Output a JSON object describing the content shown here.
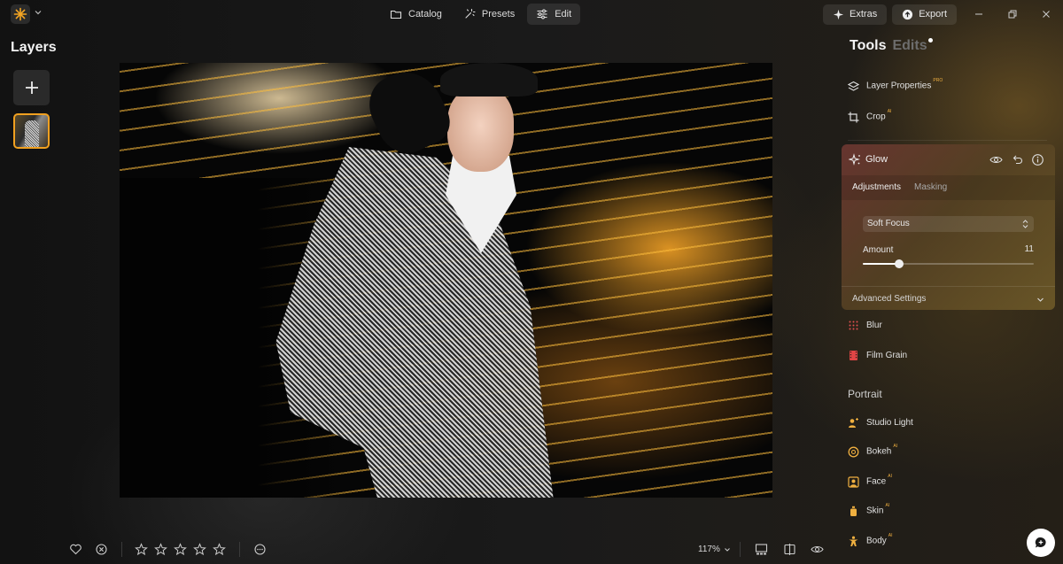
{
  "topbar": {
    "nav": [
      {
        "label": "Catalog",
        "icon": "folder-icon"
      },
      {
        "label": "Presets",
        "icon": "magic-wand-icon"
      },
      {
        "label": "Edit",
        "icon": "sliders-icon"
      }
    ],
    "extras_label": "Extras",
    "export_label": "Export"
  },
  "layers": {
    "title": "Layers"
  },
  "right_panel": {
    "tab_tools": "Tools",
    "tab_edits": "Edits",
    "tools_top": [
      {
        "label": "Layer Properties",
        "badge": "PRO"
      },
      {
        "label": "Crop",
        "badge": "AI"
      }
    ],
    "glow": {
      "title": "Glow",
      "subtab_adjustments": "Adjustments",
      "subtab_masking": "Masking",
      "preset": "Soft Focus",
      "amount_label": "Amount",
      "amount_value": "11",
      "amount_fraction": 0.11,
      "advanced_label": "Advanced Settings"
    },
    "tools_mid": [
      {
        "label": "Blur",
        "badge": ""
      },
      {
        "label": "Film Grain",
        "badge": ""
      }
    ],
    "section_portrait": "Portrait",
    "tools_portrait": [
      {
        "label": "Studio Light",
        "badge": ""
      },
      {
        "label": "Bokeh",
        "badge": "AI"
      },
      {
        "label": "Face",
        "badge": "AI"
      },
      {
        "label": "Skin",
        "badge": "AI"
      },
      {
        "label": "Body",
        "badge": "AI"
      }
    ]
  },
  "bottombar": {
    "rating_stars": 5,
    "zoom": "117%"
  },
  "colors": {
    "accent": "#f0a020",
    "badge": "#f0b040"
  }
}
